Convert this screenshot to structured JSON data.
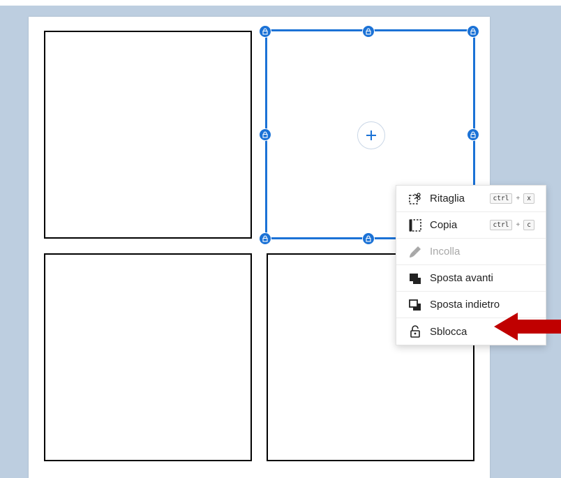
{
  "menu": {
    "items": [
      {
        "label": "Ritaglia",
        "key1": "ctrl",
        "plus": "+",
        "key2": "x",
        "icon": "cut-icon"
      },
      {
        "label": "Copia",
        "key1": "ctrl",
        "plus": "+",
        "key2": "c",
        "icon": "copy-icon"
      },
      {
        "label": "Incolla",
        "icon": "paste-icon",
        "disabled": true
      },
      {
        "label": "Sposta avanti",
        "icon": "bring-forward-icon"
      },
      {
        "label": "Sposta indietro",
        "icon": "send-backward-icon"
      },
      {
        "label": "Sblocca",
        "icon": "unlock-icon"
      }
    ]
  },
  "colors": {
    "accent": "#1b72d6",
    "background": "#bdcee0",
    "arrow": "#c00000"
  }
}
